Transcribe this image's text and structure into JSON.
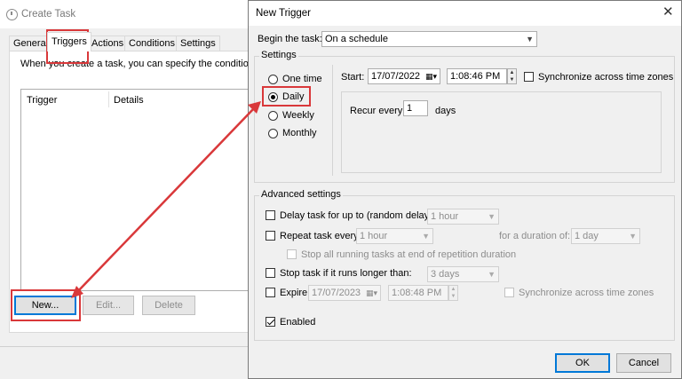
{
  "create_task": {
    "title": "Create Task",
    "tabs": [
      "General",
      "Triggers",
      "Actions",
      "Conditions",
      "Settings"
    ],
    "description": "When you create a task, you can specify the conditions that",
    "list_columns": [
      "Trigger",
      "Details"
    ],
    "buttons": {
      "new": "New...",
      "edit": "Edit...",
      "delete": "Delete"
    }
  },
  "new_trigger": {
    "title": "New Trigger",
    "close_glyph": "✕",
    "begin_label": "Begin the task:",
    "begin_value": "On a schedule",
    "settings_label": "Settings",
    "schedule_options": [
      "One time",
      "Daily",
      "Weekly",
      "Monthly"
    ],
    "selected_schedule": "Daily",
    "start_label": "Start:",
    "start_date": "17/07/2022",
    "start_time": "1:08:46 PM",
    "sync_label": "Synchronize across time zones",
    "recur_label": "Recur every:",
    "recur_value": "1",
    "recur_unit": "days",
    "advanced_label": "Advanced settings",
    "delay_label": "Delay task for up to (random delay):",
    "delay_value": "1 hour",
    "repeat_label": "Repeat task every:",
    "repeat_value": "1 hour",
    "duration_label": "for a duration of:",
    "duration_value": "1 day",
    "stop_all_label": "Stop all running tasks at end of repetition duration",
    "stop_longer_label": "Stop task if it runs longer than:",
    "stop_longer_value": "3 days",
    "expire_label": "Expire:",
    "expire_date": "17/07/2023",
    "expire_time": "1:08:48 PM",
    "expire_sync_label": "Synchronize across time zones",
    "enabled_label": "Enabled",
    "ok": "OK",
    "cancel": "Cancel"
  },
  "colors": {
    "highlight": "#d9383a",
    "focus": "#0078d7"
  }
}
